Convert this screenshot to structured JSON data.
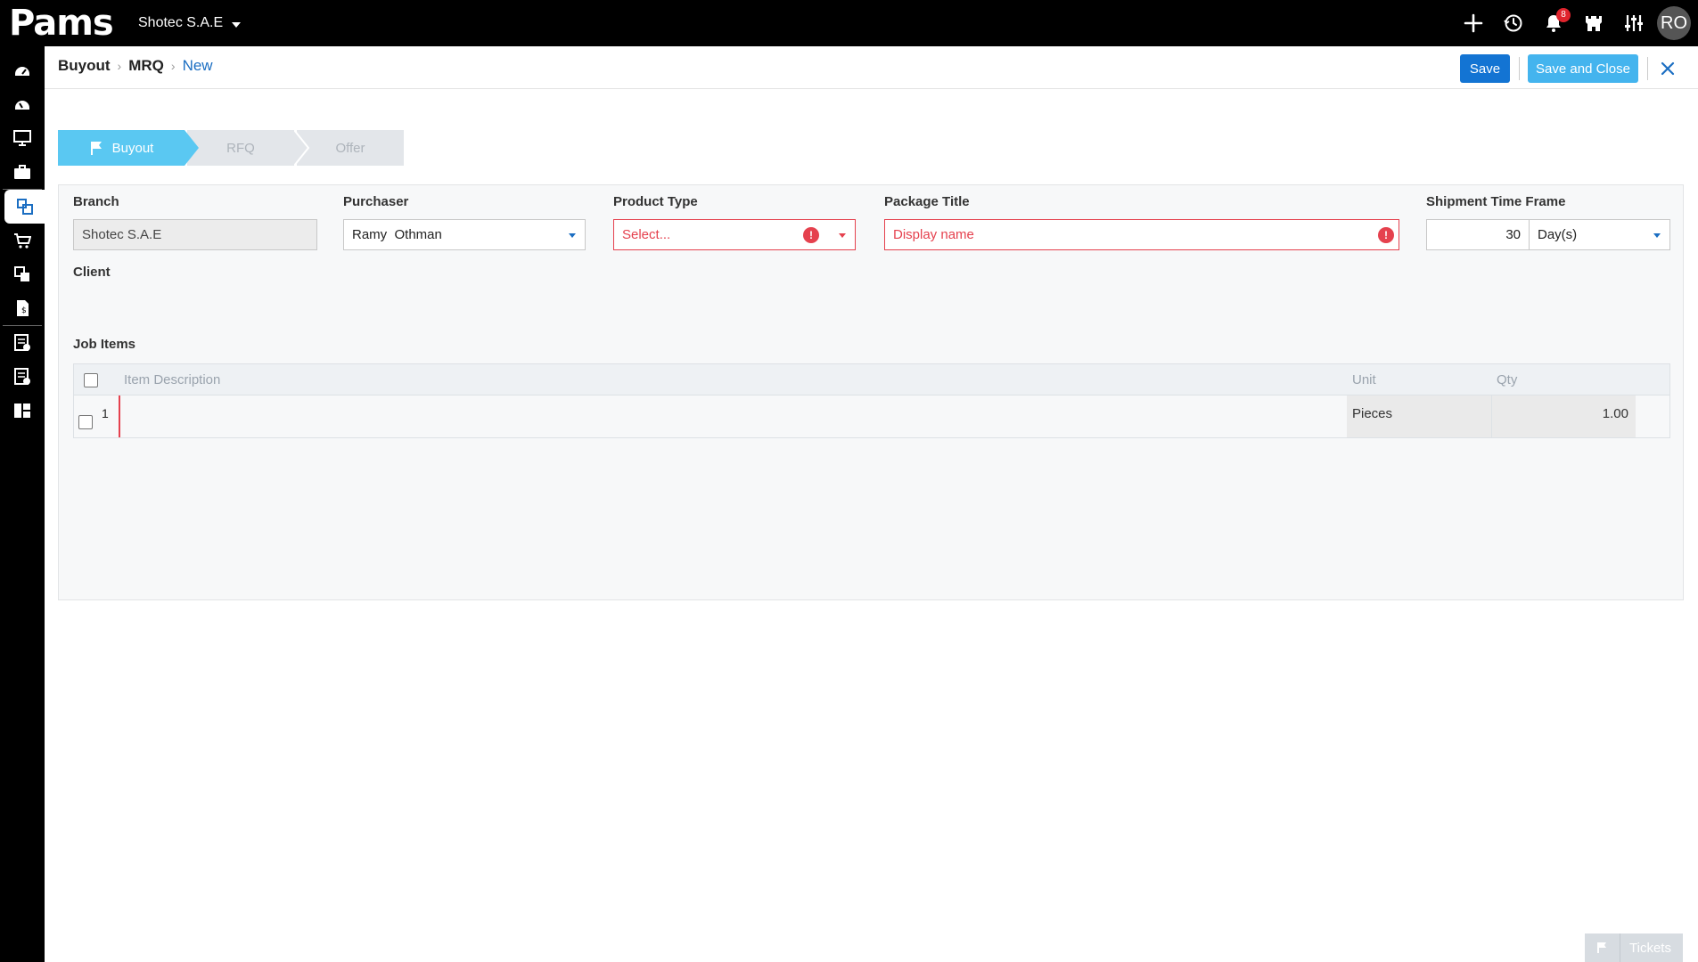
{
  "app": {
    "logo_text": "Pams",
    "company": "Shotec S.A.E"
  },
  "topbar": {
    "icons": [
      "plus-icon",
      "history-icon",
      "bell-icon",
      "castle-icon",
      "sliders-icon"
    ],
    "notification_count": "8",
    "avatar_initials": "RO"
  },
  "sidebar": {
    "items": [
      "dashboard-icon",
      "gauge-icon",
      "monitor-icon",
      "briefcase-icon",
      "buyout-icon",
      "cart-icon",
      "documents-icon",
      "invoice-icon",
      "checklist-icon",
      "report-icon",
      "grid-icon"
    ],
    "active_index": 4
  },
  "breadcrumb": {
    "items": [
      "Buyout",
      "MRQ"
    ],
    "current": "New"
  },
  "actions": {
    "save": "Save",
    "save_close": "Save and Close"
  },
  "steps": [
    "Buyout",
    "RFQ",
    "Offer"
  ],
  "form": {
    "branch_label": "Branch",
    "branch_value": "Shotec S.A.E",
    "purchaser_label": "Purchaser",
    "purchaser_value": "Ramy  Othman",
    "product_type_label": "Product Type",
    "product_type_placeholder": "Select...",
    "package_title_label": "Package Title",
    "package_title_placeholder": "Display name",
    "shipment_label": "Shipment Time Frame",
    "shipment_value": "30",
    "shipment_unit": "Day(s)",
    "client_label": "Client",
    "job_items_label": "Job Items"
  },
  "table": {
    "headers": {
      "description": "Item Description",
      "unit": "Unit",
      "qty": "Qty"
    },
    "rows": [
      {
        "index": "1",
        "description": "",
        "unit": "Pieces",
        "qty": "1.00"
      }
    ]
  },
  "tickets": {
    "label": "Tickets"
  },
  "colors": {
    "primary": "#1374d3",
    "accent": "#44b4ee",
    "step_active": "#5ac8f2",
    "error": "#e5414e"
  }
}
